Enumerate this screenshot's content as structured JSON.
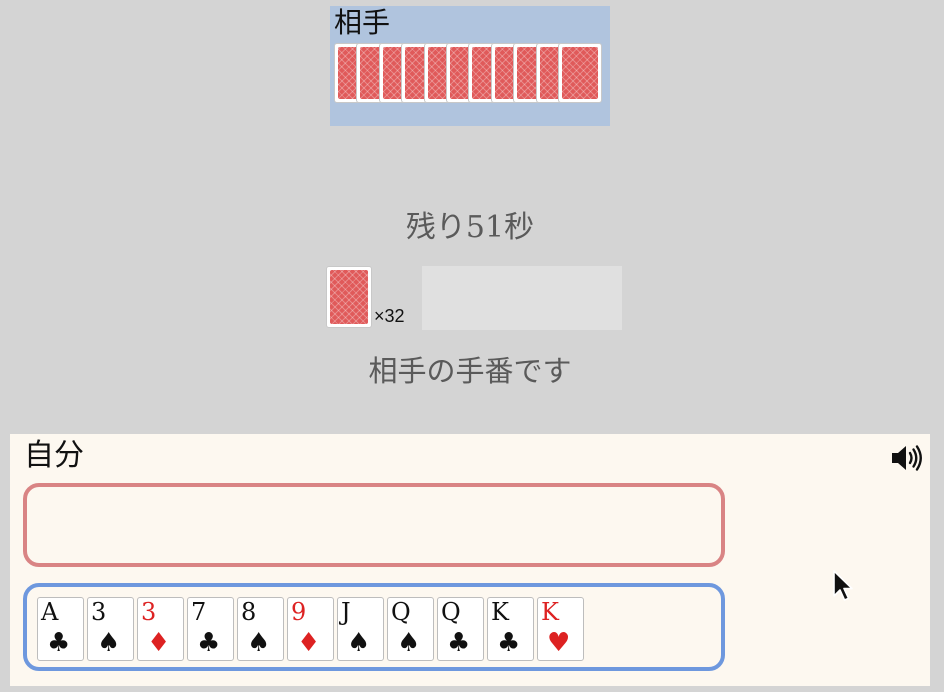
{
  "opponent": {
    "label": "相手",
    "card_count": 11
  },
  "status": {
    "timer": "残り51秒",
    "deck_count": "×32",
    "turn_message": "相手の手番です"
  },
  "self": {
    "label": "自分",
    "sound_icon": "speaker-icon",
    "hand": [
      {
        "rank": "A",
        "suit": "♣",
        "color": "black"
      },
      {
        "rank": "3",
        "suit": "♠",
        "color": "black"
      },
      {
        "rank": "3",
        "suit": "♦",
        "color": "red"
      },
      {
        "rank": "7",
        "suit": "♣",
        "color": "black"
      },
      {
        "rank": "8",
        "suit": "♠",
        "color": "black"
      },
      {
        "rank": "9",
        "suit": "♦",
        "color": "red"
      },
      {
        "rank": "J",
        "suit": "♠",
        "color": "black"
      },
      {
        "rank": "Q",
        "suit": "♠",
        "color": "black"
      },
      {
        "rank": "Q",
        "suit": "♣",
        "color": "black"
      },
      {
        "rank": "K",
        "suit": "♣",
        "color": "black"
      },
      {
        "rank": "K",
        "suit": "♥",
        "color": "red"
      }
    ]
  },
  "colors": {
    "card_back": "#e05a5a",
    "red_suit": "#dd2222",
    "play_zone_border": "#d98484",
    "hand_zone_border": "#6e98de"
  }
}
